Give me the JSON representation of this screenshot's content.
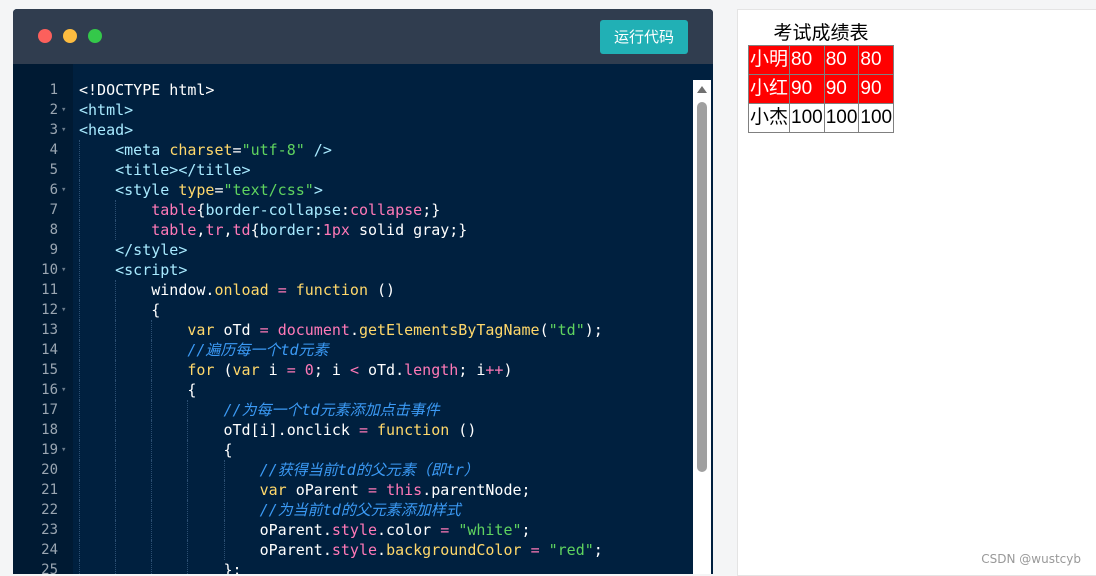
{
  "editor": {
    "run_button_label": "运行代码",
    "lines": [
      {
        "n": "1",
        "fold": false,
        "indent": 0,
        "tokens": [
          [
            "t-plain",
            "<!DOCTYPE html>"
          ]
        ]
      },
      {
        "n": "2",
        "fold": true,
        "indent": 0,
        "tokens": [
          [
            "t-tag",
            "<html>"
          ]
        ]
      },
      {
        "n": "3",
        "fold": true,
        "indent": 0,
        "tokens": [
          [
            "t-tag",
            "<head>"
          ]
        ]
      },
      {
        "n": "4",
        "fold": false,
        "indent": 1,
        "tokens": [
          [
            "t-tag",
            "<meta "
          ],
          [
            "t-attr",
            "charset"
          ],
          [
            "t-plain",
            "="
          ],
          [
            "t-str",
            "\"utf-8\""
          ],
          [
            "t-tag",
            " />"
          ]
        ]
      },
      {
        "n": "5",
        "fold": false,
        "indent": 1,
        "tokens": [
          [
            "t-tag",
            "<title></title>"
          ]
        ]
      },
      {
        "n": "6",
        "fold": true,
        "indent": 1,
        "tokens": [
          [
            "t-tag",
            "<style "
          ],
          [
            "t-attr",
            "type"
          ],
          [
            "t-plain",
            "="
          ],
          [
            "t-str",
            "\"text/css\""
          ],
          [
            "t-tag",
            ">"
          ]
        ]
      },
      {
        "n": "7",
        "fold": false,
        "indent": 2,
        "tokens": [
          [
            "t-sel",
            "table"
          ],
          [
            "t-plain",
            "{"
          ],
          [
            "t-prop",
            "border-collapse"
          ],
          [
            "t-plain",
            ":"
          ],
          [
            "t-val",
            "collapse"
          ],
          [
            "t-plain",
            ";}"
          ]
        ]
      },
      {
        "n": "8",
        "fold": false,
        "indent": 2,
        "tokens": [
          [
            "t-sel",
            "table"
          ],
          [
            "t-plain",
            ","
          ],
          [
            "t-sel",
            "tr"
          ],
          [
            "t-plain",
            ","
          ],
          [
            "t-sel",
            "td"
          ],
          [
            "t-plain",
            "{"
          ],
          [
            "t-prop",
            "border"
          ],
          [
            "t-plain",
            ":"
          ],
          [
            "t-num",
            "1px"
          ],
          [
            "t-plain",
            " solid gray;}"
          ]
        ]
      },
      {
        "n": "9",
        "fold": false,
        "indent": 1,
        "tokens": [
          [
            "t-tag",
            "</style>"
          ]
        ]
      },
      {
        "n": "10",
        "fold": true,
        "indent": 1,
        "tokens": [
          [
            "t-tag",
            "<script>"
          ]
        ]
      },
      {
        "n": "11",
        "fold": false,
        "indent": 2,
        "tokens": [
          [
            "t-plain",
            "window."
          ],
          [
            "t-fn",
            "onload"
          ],
          [
            "t-plain",
            " "
          ],
          [
            "t-op",
            "="
          ],
          [
            "t-plain",
            " "
          ],
          [
            "t-kw",
            "function"
          ],
          [
            "t-plain",
            " ()"
          ]
        ]
      },
      {
        "n": "12",
        "fold": true,
        "indent": 2,
        "tokens": [
          [
            "t-plain",
            "{"
          ]
        ]
      },
      {
        "n": "13",
        "fold": false,
        "indent": 3,
        "tokens": [
          [
            "t-kw",
            "var"
          ],
          [
            "t-plain",
            " oTd "
          ],
          [
            "t-op",
            "="
          ],
          [
            "t-plain",
            " "
          ],
          [
            "t-sel",
            "document"
          ],
          [
            "t-plain",
            "."
          ],
          [
            "t-fn",
            "getElementsByTagName"
          ],
          [
            "t-plain",
            "("
          ],
          [
            "t-str",
            "\"td\""
          ],
          [
            "t-plain",
            ");"
          ]
        ]
      },
      {
        "n": "14",
        "fold": false,
        "indent": 3,
        "tokens": [
          [
            "t-cm",
            "//遍历每一个td元素"
          ]
        ]
      },
      {
        "n": "15",
        "fold": false,
        "indent": 3,
        "tokens": [
          [
            "t-kw",
            "for"
          ],
          [
            "t-plain",
            " ("
          ],
          [
            "t-kw",
            "var"
          ],
          [
            "t-plain",
            " i "
          ],
          [
            "t-op",
            "="
          ],
          [
            "t-plain",
            " "
          ],
          [
            "t-num",
            "0"
          ],
          [
            "t-plain",
            "; i "
          ],
          [
            "t-op",
            "<"
          ],
          [
            "t-plain",
            " oTd."
          ],
          [
            "t-val",
            "length"
          ],
          [
            "t-plain",
            "; i"
          ],
          [
            "t-op",
            "++"
          ],
          [
            "t-plain",
            ")"
          ]
        ]
      },
      {
        "n": "16",
        "fold": true,
        "indent": 3,
        "tokens": [
          [
            "t-plain",
            "{"
          ]
        ]
      },
      {
        "n": "17",
        "fold": false,
        "indent": 4,
        "tokens": [
          [
            "t-cm",
            "//为每一个td元素添加点击事件"
          ]
        ]
      },
      {
        "n": "18",
        "fold": false,
        "indent": 4,
        "tokens": [
          [
            "t-plain",
            "oTd[i].onclick "
          ],
          [
            "t-op",
            "="
          ],
          [
            "t-plain",
            " "
          ],
          [
            "t-kw",
            "function"
          ],
          [
            "t-plain",
            " ()"
          ]
        ]
      },
      {
        "n": "19",
        "fold": true,
        "indent": 4,
        "tokens": [
          [
            "t-plain",
            "{"
          ]
        ]
      },
      {
        "n": "20",
        "fold": false,
        "indent": 5,
        "tokens": [
          [
            "t-cm",
            "//获得当前td的父元素（即tr）"
          ]
        ]
      },
      {
        "n": "21",
        "fold": false,
        "indent": 5,
        "tokens": [
          [
            "t-kw",
            "var"
          ],
          [
            "t-plain",
            " oParent "
          ],
          [
            "t-op",
            "="
          ],
          [
            "t-plain",
            " "
          ],
          [
            "t-val",
            "this"
          ],
          [
            "t-plain",
            ".parentNode;"
          ]
        ]
      },
      {
        "n": "22",
        "fold": false,
        "indent": 5,
        "tokens": [
          [
            "t-cm",
            "//为当前td的父元素添加样式"
          ]
        ]
      },
      {
        "n": "23",
        "fold": false,
        "indent": 5,
        "tokens": [
          [
            "t-plain",
            "oParent."
          ],
          [
            "t-val",
            "style"
          ],
          [
            "t-plain",
            ".color "
          ],
          [
            "t-op",
            "="
          ],
          [
            "t-plain",
            " "
          ],
          [
            "t-str",
            "\"white\""
          ],
          [
            "t-plain",
            ";"
          ]
        ]
      },
      {
        "n": "24",
        "fold": false,
        "indent": 5,
        "tokens": [
          [
            "t-plain",
            "oParent."
          ],
          [
            "t-val",
            "style"
          ],
          [
            "t-plain",
            "."
          ],
          [
            "t-fn",
            "backgroundColor"
          ],
          [
            "t-plain",
            " "
          ],
          [
            "t-op",
            "="
          ],
          [
            "t-plain",
            " "
          ],
          [
            "t-str",
            "\"red\""
          ],
          [
            "t-plain",
            ";"
          ]
        ]
      },
      {
        "n": "25",
        "fold": false,
        "indent": 4,
        "tokens": [
          [
            "t-plain",
            "};"
          ]
        ]
      }
    ]
  },
  "preview": {
    "caption": "考试成绩表",
    "rows": [
      {
        "highlight": true,
        "cells": [
          "小明",
          "80",
          "80",
          "80"
        ]
      },
      {
        "highlight": true,
        "cells": [
          "小红",
          "90",
          "90",
          "90"
        ]
      },
      {
        "highlight": false,
        "cells": [
          "小杰",
          "100",
          "100",
          "100"
        ]
      }
    ]
  },
  "watermark": "CSDN @wustcyb",
  "colors": {
    "editor_bg": "#00203f",
    "titlebar_bg": "#303d4f",
    "run_button_bg": "#21b0b5",
    "highlight_row_bg": "#ff0000"
  },
  "icons": [
    "close-dot-icon",
    "minimize-dot-icon",
    "maximize-dot-icon",
    "fold-arrow-icon",
    "scroll-up-arrow-icon"
  ]
}
